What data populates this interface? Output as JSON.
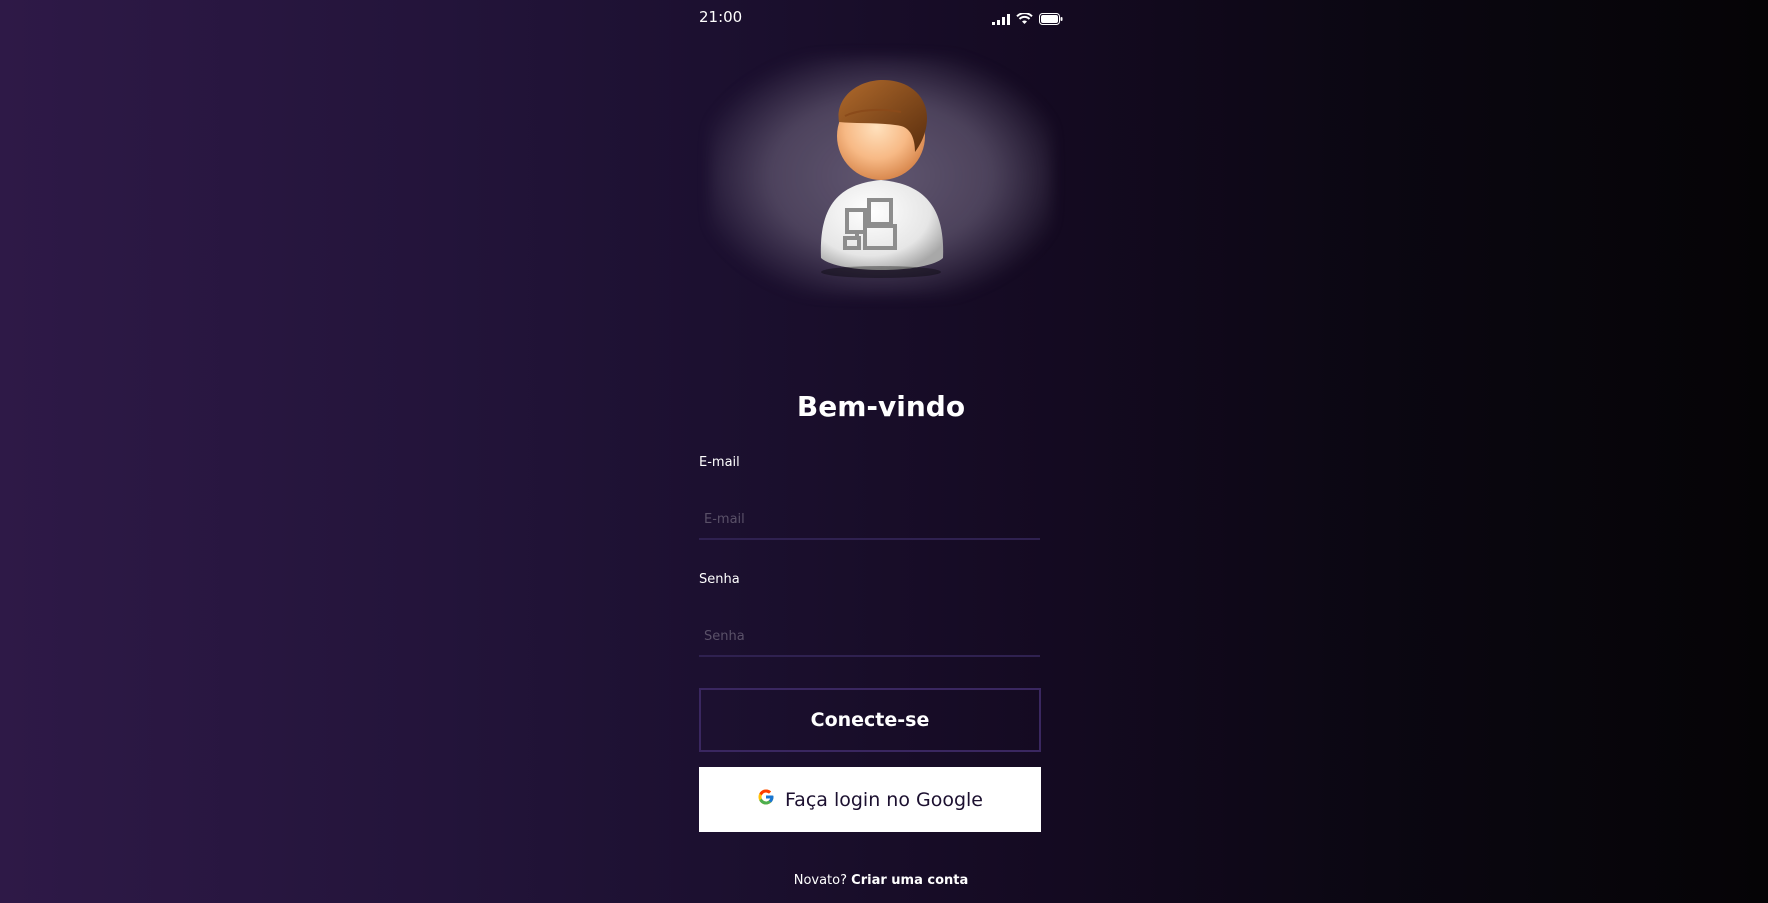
{
  "status_bar": {
    "time": "21:00",
    "icons": [
      "signal-icon",
      "wifi-icon",
      "battery-icon"
    ]
  },
  "avatar": {
    "icon": "user-avatar-icon"
  },
  "welcome": {
    "title": "Bem-vindo"
  },
  "email": {
    "label": "E-mail",
    "placeholder": "E-mail",
    "value": ""
  },
  "password": {
    "label": "Senha",
    "placeholder": "Senha",
    "value": ""
  },
  "connect_button": {
    "label": "Conecte-se"
  },
  "google_button": {
    "label": "Faça login no Google",
    "icon": "google-icon"
  },
  "signup": {
    "prompt": "Novato?",
    "link": "Criar uma conta"
  },
  "colors": {
    "background_left": "#2e1947",
    "background_right": "#050406",
    "input_border": "#2f2150",
    "button_border": "#3a2760",
    "google_bg": "#ffffff"
  }
}
